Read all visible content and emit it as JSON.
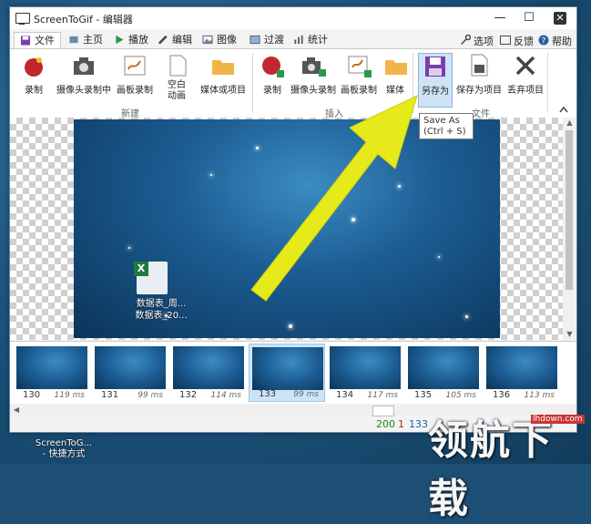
{
  "window": {
    "title": "ScreenToGif - 编辑器"
  },
  "tabs": [
    {
      "label": "文件"
    },
    {
      "label": "主页"
    },
    {
      "label": "播放"
    },
    {
      "label": "编辑"
    },
    {
      "label": "图像"
    },
    {
      "label": "过渡"
    },
    {
      "label": "统计"
    }
  ],
  "right_tabs": {
    "options": "选项",
    "feedback": "反馈",
    "help": "帮助"
  },
  "ribbon": {
    "new": {
      "record": "录制",
      "webcam": "摄像头录制中",
      "board": "画板录制",
      "blank": "空白\n动画",
      "media": "媒体或项目",
      "group": "新建"
    },
    "insert": {
      "record": "录制",
      "webcam": "摄像头录制",
      "board": "画板录制",
      "media": "媒体",
      "group": "插入"
    },
    "file": {
      "save_as": "另存为",
      "save_project": "保存为项目",
      "discard": "丢弃项目",
      "group": "文件"
    }
  },
  "tooltip": {
    "line1": "Save As",
    "line2": "(Ctrl + S)"
  },
  "canvas": {
    "file_caption_1": "数据表_周...",
    "file_caption_2": "数据表_20..."
  },
  "frames": [
    {
      "num": "130",
      "ms": "119 ms"
    },
    {
      "num": "131",
      "ms": "99 ms"
    },
    {
      "num": "132",
      "ms": "114 ms"
    },
    {
      "num": "133",
      "ms": "99 ms"
    },
    {
      "num": "134",
      "ms": "117 ms"
    },
    {
      "num": "135",
      "ms": "105 ms"
    },
    {
      "num": "136",
      "ms": "113 ms"
    }
  ],
  "status": {
    "total": "200",
    "selected": "1",
    "current": "133"
  },
  "desktop": {
    "icon_line1": "ScreenToG...",
    "icon_line2": "- 快捷方式"
  },
  "watermark": {
    "url": "lhdown.com",
    "text": "领航下载"
  },
  "colors": {
    "accent": "#1a5fb4",
    "arrow": "#e6ea1a",
    "highlight": "#cfe3f7"
  }
}
